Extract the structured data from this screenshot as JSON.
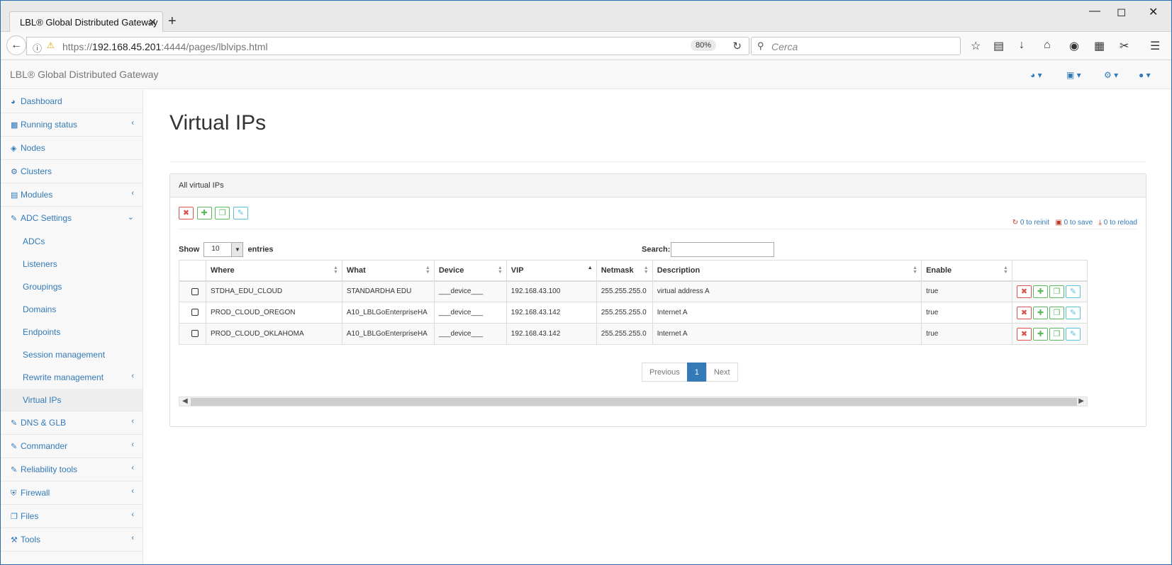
{
  "browser": {
    "tab_title": "LBL® Global Distributed Gateway",
    "tab_close": "✕",
    "new_tab": "+",
    "url_prefix": "https://",
    "url_host": "192.168.45.201",
    "url_rest": ":4444/pages/lblvips.html",
    "zoom": "80%",
    "search_placeholder": "Cerca"
  },
  "app": {
    "brand": "LBL® Global Distributed Gateway"
  },
  "sidebar": {
    "items": [
      {
        "label": "Dashboard",
        "icon": "dashboard-icon"
      },
      {
        "label": "Running status",
        "icon": "bar-chart-icon"
      },
      {
        "label": "Nodes",
        "icon": "cube-icon"
      },
      {
        "label": "Clusters",
        "icon": "cogs-icon"
      },
      {
        "label": "Modules",
        "icon": "list-icon"
      },
      {
        "label": "ADC Settings",
        "icon": "edit-icon"
      },
      {
        "label": "DNS & GLB",
        "icon": "edit-icon"
      },
      {
        "label": "Commander",
        "icon": "edit-icon"
      },
      {
        "label": "Reliability tools",
        "icon": "edit-icon"
      },
      {
        "label": "Firewall",
        "icon": "shield-icon"
      },
      {
        "label": "Files",
        "icon": "files-icon"
      },
      {
        "label": "Tools",
        "icon": "wrench-icon"
      }
    ],
    "subitems": [
      {
        "label": "ADCs"
      },
      {
        "label": "Listeners"
      },
      {
        "label": "Groupings"
      },
      {
        "label": "Domains"
      },
      {
        "label": "Endpoints"
      },
      {
        "label": "Session management"
      },
      {
        "label": "Rewrite management"
      },
      {
        "label": "Virtual IPs"
      }
    ]
  },
  "main": {
    "title": "Virtual IPs",
    "panel_heading": "All virtual IPs",
    "pending": {
      "reinit": "0 to reinit",
      "save": "0 to save",
      "reload": "0 to reload"
    },
    "show_label": "Show",
    "entries_value": "10",
    "entries_label": "entries",
    "search_label": "Search:",
    "columns": [
      "Where",
      "What",
      "Device",
      "VIP",
      "Netmask",
      "Description",
      "Enable"
    ],
    "rows": [
      {
        "where": "STDHA_EDU_CLOUD",
        "what": "STANDARDHA EDU",
        "device": "___device___",
        "vip": "192.168.43.100",
        "netmask": "255.255.255.0",
        "description": "virtual address A",
        "enable": "true"
      },
      {
        "where": "PROD_CLOUD_OREGON",
        "what": "A10_LBLGoEnterpriseHA",
        "device": "___device___",
        "vip": "192.168.43.142",
        "netmask": "255.255.255.0",
        "description": "Internet A",
        "enable": "true"
      },
      {
        "where": "PROD_CLOUD_OKLAHOMA",
        "what": "A10_LBLGoEnterpriseHA",
        "device": "___device___",
        "vip": "192.168.43.142",
        "netmask": "255.255.255.0",
        "description": "Internet A",
        "enable": "true"
      }
    ],
    "pagination": {
      "previous": "Previous",
      "page": "1",
      "next": "Next"
    }
  },
  "colors": {
    "link": "#337ab7",
    "danger": "#d9534f",
    "success": "#5cb85c",
    "info": "#5bc0de"
  }
}
